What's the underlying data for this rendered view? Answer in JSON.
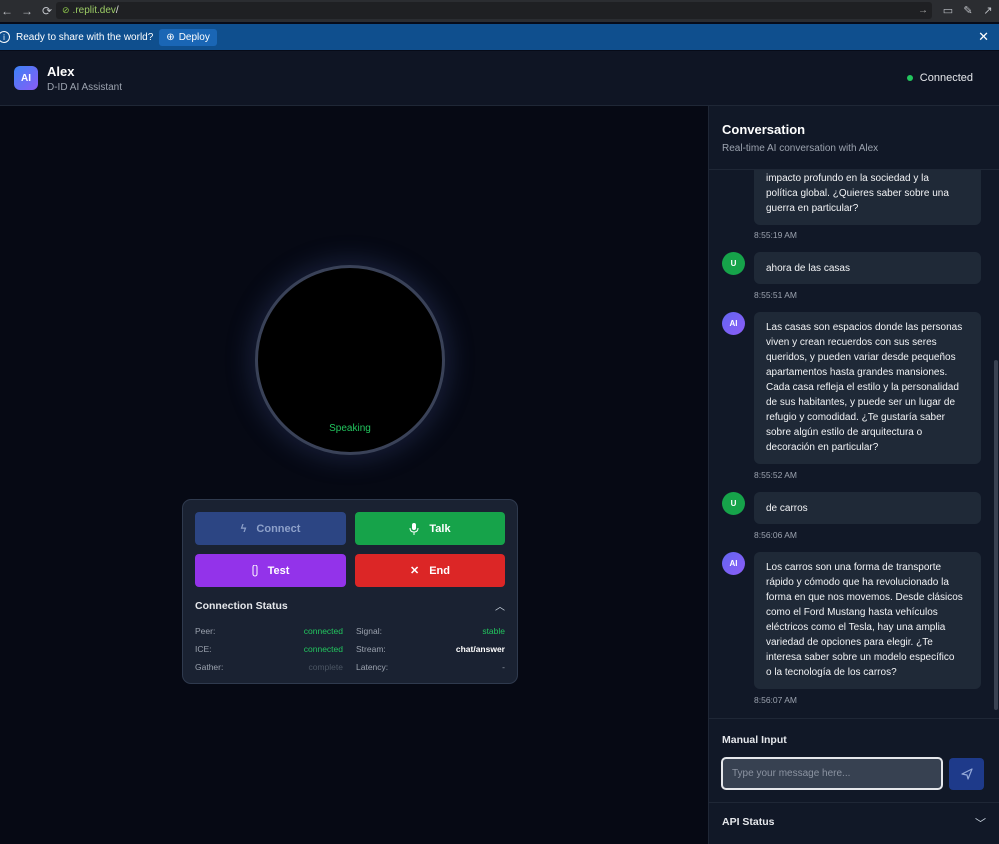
{
  "browser": {
    "url_domain": ".replit.dev",
    "url_path": "/"
  },
  "banner": {
    "message": "Ready to share with the world?",
    "deploy_label": "Deploy"
  },
  "header": {
    "avatar": "AI",
    "name": "Alex",
    "subtitle": "D-ID AI Assistant",
    "status": "Connected"
  },
  "stage": {
    "state_label": "Speaking"
  },
  "controls": {
    "connect": "Connect",
    "talk": "Talk",
    "test": "Test",
    "end": "End"
  },
  "connection_status": {
    "title": "Connection Status",
    "rows": [
      {
        "label": "Peer:",
        "value": "connected",
        "color": "#22c55e"
      },
      {
        "label": "Signal:",
        "value": "stable",
        "color": "#22c55e"
      },
      {
        "label": "ICE:",
        "value": "connected",
        "color": "#22c55e"
      },
      {
        "label": "Stream:",
        "value": "chat/answer",
        "color": "#ffffff"
      },
      {
        "label": "Gather:",
        "value": "complete",
        "color": "#4b5563"
      },
      {
        "label": "Latency:",
        "value": "-",
        "color": "#9ca3af"
      }
    ]
  },
  "conversation": {
    "title": "Conversation",
    "subtitle": "Real-time AI conversation with Alex",
    "messages": [
      {
        "role": "AI",
        "lines": [
          "impacto profundo en la sociedad y la",
          "política global. ¿Quieres saber sobre una",
          "guerra en particular?"
        ],
        "time": "8:55:19 AM"
      },
      {
        "role": "U",
        "lines": [
          "ahora de las casas"
        ],
        "time": "8:55:51 AM"
      },
      {
        "role": "AI",
        "lines": [
          "Las casas son espacios donde las personas",
          "viven y crean recuerdos con sus seres",
          "queridos, y pueden variar desde pequeños",
          "apartamentos hasta grandes mansiones.",
          "Cada casa refleja el estilo y la personalidad",
          "de sus habitantes, y puede ser un lugar de",
          "refugio y comodidad. ¿Te gustaría saber",
          "sobre algún estilo de arquitectura o",
          "decoración en particular?"
        ],
        "time": "8:55:52 AM"
      },
      {
        "role": "U",
        "lines": [
          "de carros"
        ],
        "time": "8:56:06 AM"
      },
      {
        "role": "AI",
        "lines": [
          "Los carros son una forma de transporte",
          "rápido y cómodo que ha revolucionado la",
          "forma en que nos movemos. Desde clásicos",
          "como el Ford Mustang hasta vehículos",
          "eléctricos como el Tesla, hay una amplia",
          "variedad de opciones para elegir. ¿Te",
          "interesa saber sobre un modelo específico",
          "o la tecnología de los carros?"
        ],
        "time": "8:56:07 AM"
      }
    ]
  },
  "manual_input": {
    "title": "Manual Input",
    "placeholder": "Type your message here..."
  },
  "api_status": {
    "title": "API Status"
  }
}
